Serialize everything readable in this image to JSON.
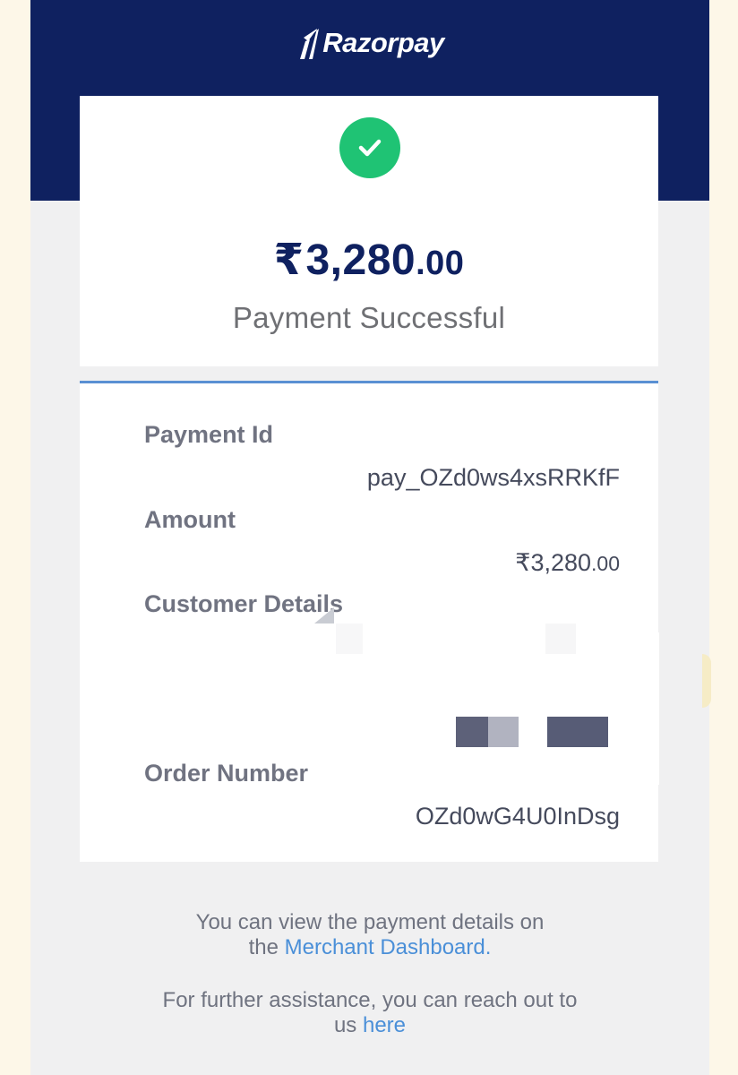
{
  "brand": {
    "name": "Razorpay",
    "logo_icon": "razorpay-logo-icon"
  },
  "colors": {
    "header": "#0f2160",
    "success": "#1fc374",
    "link": "#4a8fd8",
    "divider": "#5a90d3"
  },
  "summary": {
    "status_icon": "check-circle-icon",
    "currency": "₹",
    "amount_main": "3,280",
    "amount_paise": ".00",
    "status": "Payment Successful"
  },
  "details": {
    "payment_id_label": "Payment Id",
    "payment_id": "pay_OZd0ws4xsRRKfF",
    "amount_label": "Amount",
    "amount_main": "₹3,280",
    "amount_paise": ".00",
    "customer_label": "Customer Details",
    "order_label": "Order Number",
    "order_number": "OZd0wG4U0InDsg"
  },
  "footer": {
    "dashboard_prefix": "You can view the payment details on",
    "dashboard_the": "the",
    "dashboard_link": "Merchant Dashboard.",
    "assist_prefix": "For further assistance, you can reach out to",
    "assist_us": "us",
    "assist_link": "here"
  }
}
